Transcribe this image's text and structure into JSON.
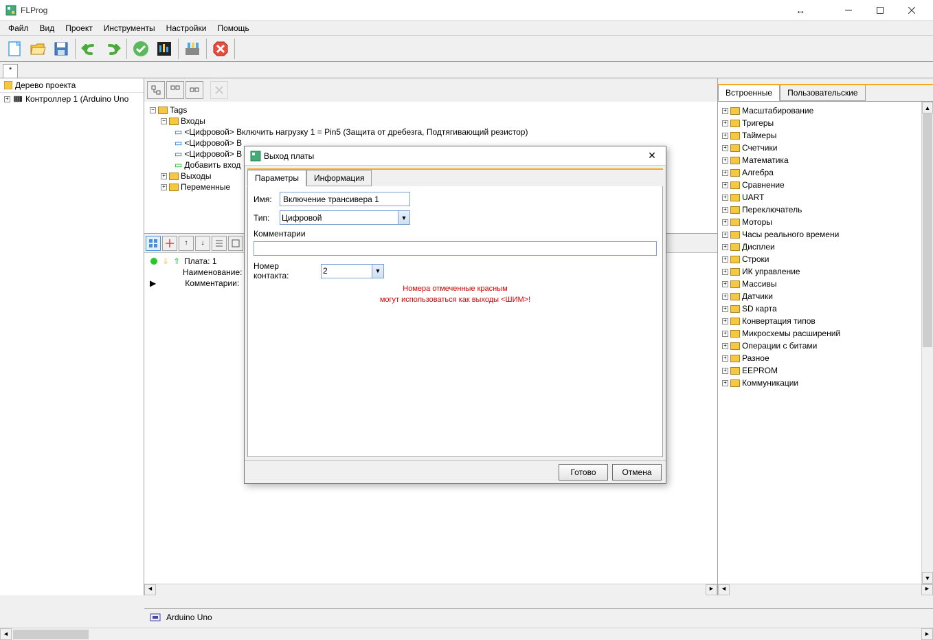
{
  "app": {
    "title": "FLProg"
  },
  "menu": {
    "items": [
      "Файл",
      "Вид",
      "Проект",
      "Инструменты",
      "Настройки",
      "Помощь"
    ]
  },
  "doc_tab": "*",
  "left_panel": {
    "header": "Дерево проекта",
    "item1": "Контроллер 1 (Arduino Uno"
  },
  "tags_tree": {
    "root": "Tags",
    "inputs": "Входы",
    "input1": "<Цифровой>  Включить нагрузку 1 = Pin5 (Защита от дребезга, Подтягивающий резистор)",
    "input2": "<Цифровой>  В",
    "input3": "<Цифровой>  В",
    "add_input": "Добавить вход",
    "outputs": "Выходы",
    "vars": "Переменные"
  },
  "canvas": {
    "plate": "Плата: 1",
    "name_label": "Наименование:",
    "comments_label": "Комментарии:"
  },
  "right_panel": {
    "tab1": "Встроенные",
    "tab2": "Пользовательские",
    "items": [
      "Масштабирование",
      "Тригеры",
      "Таймеры",
      "Счетчики",
      "Математика",
      "Алгебра",
      "Сравнение",
      "UART",
      "Переключатель",
      "Моторы",
      "Часы реального времени",
      "Дисплеи",
      "Строки",
      "ИК управление",
      "Массивы",
      "Датчики",
      "SD карта",
      "Конвертация типов",
      "Микросхемы расширений",
      "Операции с битами",
      "Разное",
      "EEPROM",
      "Коммуникации"
    ]
  },
  "status": {
    "board": "Arduino Uno"
  },
  "dialog": {
    "title": "Выход платы",
    "tab_params": "Параметры",
    "tab_info": "Информация",
    "name_label": "Имя:",
    "name_value": "Включение трансивера 1",
    "type_label": "Тип:",
    "type_value": "Цифровой",
    "comments_label": "Комментарии",
    "comments_value": "",
    "contact_label": "Номер контакта:",
    "contact_value": "2",
    "warn1": "Номера отмеченные красным",
    "warn2": "могут использоваться как выходы <ШИМ>!",
    "btn_ok": "Готово",
    "btn_cancel": "Отмена"
  }
}
